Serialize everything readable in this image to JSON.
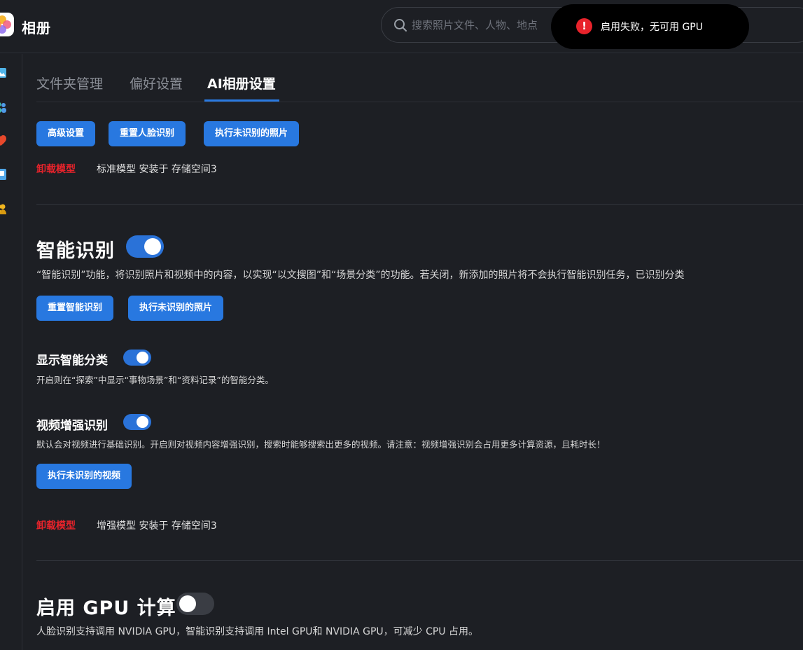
{
  "app": {
    "title": "相册"
  },
  "search": {
    "placeholder": "搜索照片文件、人物、地点"
  },
  "toast": {
    "message": "启用失败，无可用 GPU",
    "icon": "error-icon"
  },
  "tabs": [
    {
      "label": "文件夹管理",
      "active": false
    },
    {
      "label": "偏好设置",
      "active": false
    },
    {
      "label": "AI相册设置",
      "active": true
    }
  ],
  "face_section": {
    "buttons": [
      "高级设置",
      "重置人脸识别",
      "执行未识别的照片"
    ],
    "uninstall_label": "卸载模型",
    "model_info": "标准模型 安装于 存储空间3"
  },
  "smart_section": {
    "title": "智能识别",
    "enabled": true,
    "description": "“智能识别”功能，将识别照片和视频中的内容，以实现“以文搜图”和“场景分类”的功能。若关闭，新添加的照片将不会执行智能识别任务，已识别分类",
    "buttons": [
      "重置智能识别",
      "执行未识别的照片"
    ],
    "show_category": {
      "title": "显示智能分类",
      "enabled": true,
      "description": "开启则在“探索”中显示“事物场景”和“资料记录”的智能分类。"
    },
    "video_enhance": {
      "title": "视频增强识别",
      "enabled": true,
      "description": "默认会对视频进行基础识别。开启则对视频内容增强识别，搜索时能够搜索出更多的视频。请注意：视频增强识别会占用更多计算资源，且耗时长！",
      "button": "执行未识别的视频"
    },
    "uninstall_label": "卸载模型",
    "model_info": "增强模型 安装于 存储空间3"
  },
  "gpu_section": {
    "title": "启用 GPU 计算",
    "enabled": false,
    "description": "人脸识别支持调用 NVIDIA GPU，智能识别支持调用 Intel GPU和 NVIDIA GPU，可减少 CPU 占用。"
  },
  "sidebar": {
    "icons": [
      "photos-icon",
      "people-icon",
      "heart-icon",
      "album-icon",
      "shared-icon"
    ]
  },
  "colors": {
    "accent": "#2878e0",
    "danger": "#e8232b",
    "background": "#1d1f24"
  }
}
